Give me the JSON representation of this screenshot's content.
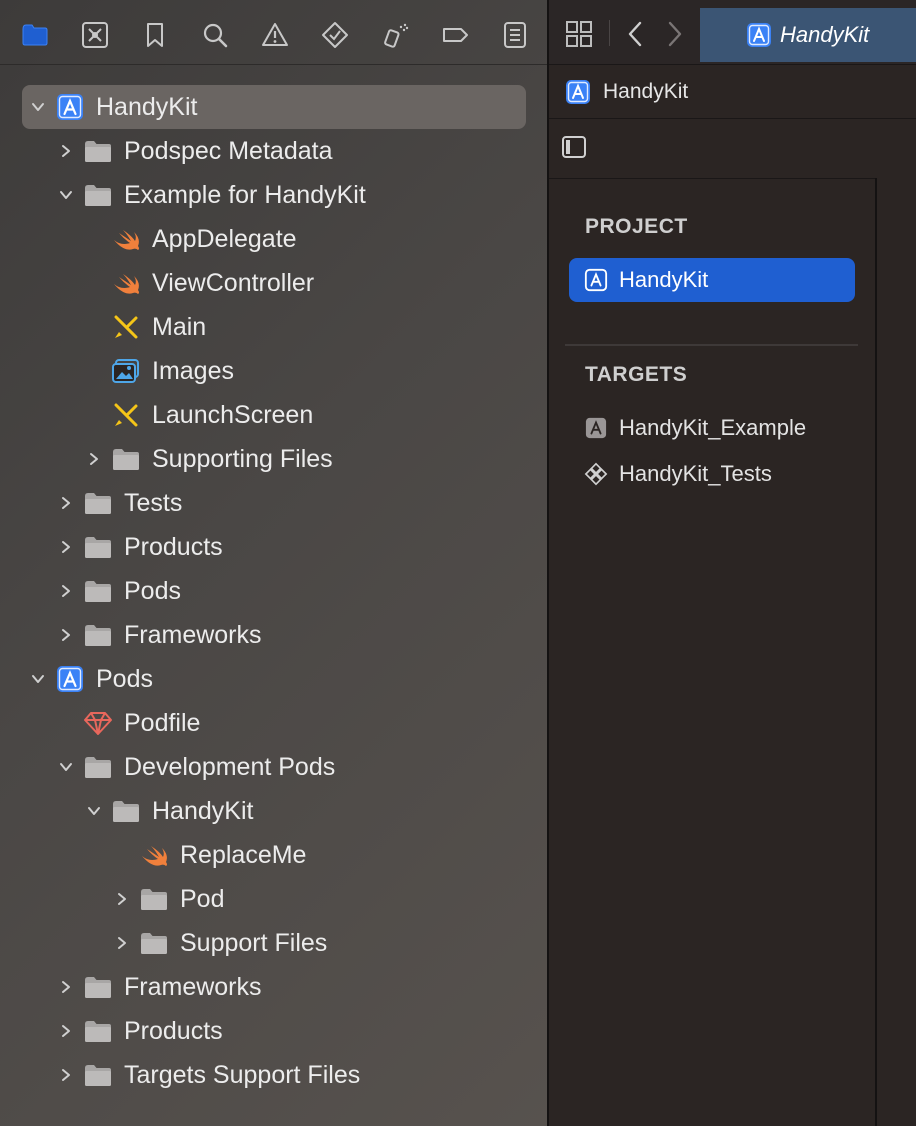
{
  "navigator": {
    "toolbar": [
      {
        "icon": "folder-icon",
        "active": true
      },
      {
        "icon": "source-control-icon",
        "active": false
      },
      {
        "icon": "bookmark-icon",
        "active": false
      },
      {
        "icon": "search-icon",
        "active": false
      },
      {
        "icon": "warning-icon",
        "active": false
      },
      {
        "icon": "test-diamond-icon",
        "active": false
      },
      {
        "icon": "debug-spray-icon",
        "active": false
      },
      {
        "icon": "breakpoint-icon",
        "active": false
      },
      {
        "icon": "report-icon",
        "active": false
      }
    ],
    "tree": [
      {
        "label": "HandyKit",
        "icon": "xcode-project-icon",
        "depth": 0,
        "disclosure": "open",
        "selected": true
      },
      {
        "label": "Podspec Metadata",
        "icon": "folder-icon",
        "depth": 1,
        "disclosure": "closed"
      },
      {
        "label": "Example for HandyKit",
        "icon": "folder-icon",
        "depth": 1,
        "disclosure": "open"
      },
      {
        "label": "AppDelegate",
        "icon": "swift-file-icon",
        "depth": 2,
        "disclosure": "none"
      },
      {
        "label": "ViewController",
        "icon": "swift-file-icon",
        "depth": 2,
        "disclosure": "none"
      },
      {
        "label": "Main",
        "icon": "storyboard-icon",
        "depth": 2,
        "disclosure": "none"
      },
      {
        "label": "Images",
        "icon": "asset-catalog-icon",
        "depth": 2,
        "disclosure": "none"
      },
      {
        "label": "LaunchScreen",
        "icon": "storyboard-icon",
        "depth": 2,
        "disclosure": "none"
      },
      {
        "label": "Supporting Files",
        "icon": "folder-icon",
        "depth": 2,
        "disclosure": "closed"
      },
      {
        "label": "Tests",
        "icon": "folder-icon",
        "depth": 1,
        "disclosure": "closed"
      },
      {
        "label": "Products",
        "icon": "folder-icon",
        "depth": 1,
        "disclosure": "closed"
      },
      {
        "label": "Pods",
        "icon": "folder-icon",
        "depth": 1,
        "disclosure": "closed"
      },
      {
        "label": "Frameworks",
        "icon": "folder-icon",
        "depth": 1,
        "disclosure": "closed"
      },
      {
        "label": "Pods",
        "icon": "xcode-project-icon",
        "depth": 0,
        "disclosure": "open"
      },
      {
        "label": "Podfile",
        "icon": "ruby-gem-icon",
        "depth": 1,
        "disclosure": "none"
      },
      {
        "label": "Development Pods",
        "icon": "folder-icon",
        "depth": 1,
        "disclosure": "open"
      },
      {
        "label": "HandyKit",
        "icon": "folder-icon",
        "depth": 2,
        "disclosure": "open"
      },
      {
        "label": "ReplaceMe",
        "icon": "swift-file-icon",
        "depth": 3,
        "disclosure": "none"
      },
      {
        "label": "Pod",
        "icon": "folder-icon",
        "depth": 3,
        "disclosure": "closed"
      },
      {
        "label": "Support Files",
        "icon": "folder-icon",
        "depth": 3,
        "disclosure": "closed"
      },
      {
        "label": "Frameworks",
        "icon": "folder-icon",
        "depth": 1,
        "disclosure": "closed"
      },
      {
        "label": "Products",
        "icon": "folder-icon",
        "depth": 1,
        "disclosure": "closed"
      },
      {
        "label": "Targets Support Files",
        "icon": "folder-icon",
        "depth": 1,
        "disclosure": "closed"
      }
    ]
  },
  "editor": {
    "tab": {
      "label": "HandyKit",
      "icon": "xcode-project-icon"
    },
    "jumpbar": {
      "label": "HandyKit",
      "icon": "xcode-project-icon"
    },
    "project_section": {
      "title": "PROJECT",
      "items": [
        {
          "label": "HandyKit",
          "icon": "xcode-project-icon",
          "selected": true
        }
      ]
    },
    "targets_section": {
      "title": "TARGETS",
      "items": [
        {
          "label": "HandyKit_Example",
          "icon": "app-target-icon"
        },
        {
          "label": "HandyKit_Tests",
          "icon": "test-target-icon"
        }
      ]
    }
  },
  "colors": {
    "accent": "#1f5fd1",
    "folder": "#a8a6a5",
    "swift": "#f0803c",
    "project": "#3b82f6",
    "storyboard": "#f5c518",
    "gem": "#e8675c"
  }
}
